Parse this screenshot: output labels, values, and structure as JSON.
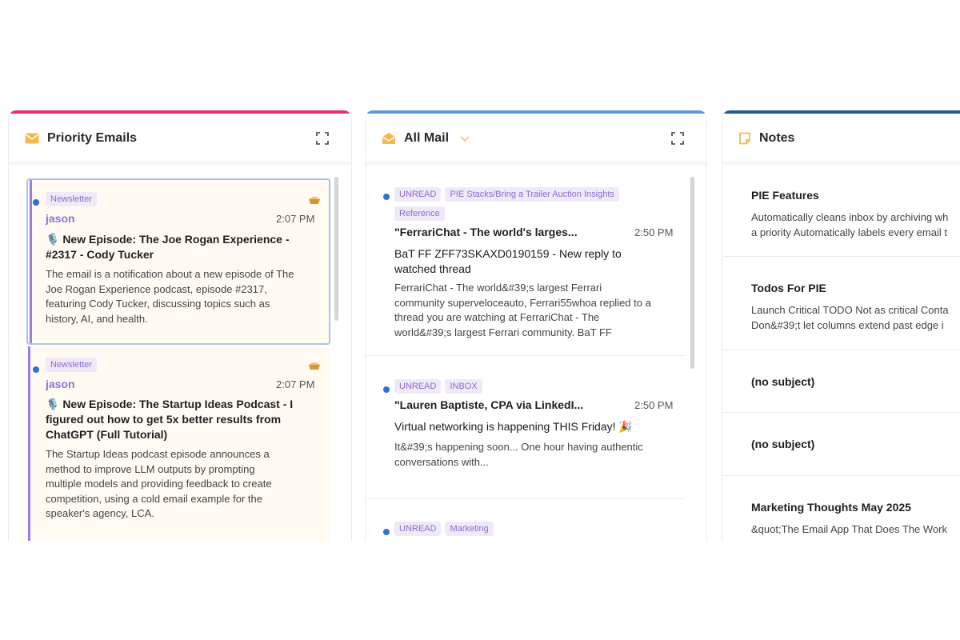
{
  "colors": {
    "priority_bar": "#e8306d",
    "allmail_bar": "#5b96d9",
    "notes_bar": "#27598f",
    "tag_text": "#8a6fd0",
    "sender": "#8e72d8",
    "unread_dot": "#2f6fd6"
  },
  "priority": {
    "title": "Priority Emails",
    "icon": "envelope-icon",
    "emails": [
      {
        "tag": "Newsletter",
        "sender": "jason",
        "time": "2:07 PM",
        "subject_line1": "🎙️ New Episode: The Joe Rogan Experience -",
        "subject_line2": "#2317 - Cody Tucker",
        "preview_lines": [
          "The email is a notification about a new episode of The",
          "Joe Rogan Experience podcast, episode #2317,",
          "featuring Cody Tucker, discussing topics such as",
          "history, AI, and health."
        ]
      },
      {
        "tag": "Newsletter",
        "sender": "jason",
        "time": "2:07 PM",
        "subject_line1": "🎙️ New Episode: The Startup Ideas Podcast - I",
        "subject_line2": "figured out how to get 5x better results from",
        "subject_line3": "ChatGPT (Full Tutorial)",
        "preview_lines": [
          "The Startup Ideas podcast episode announces a",
          "method to improve LLM outputs by prompting",
          "multiple models and providing feedback to create",
          "competition, using a cold email example for the",
          "speaker's agency, LCA."
        ]
      }
    ]
  },
  "allmail": {
    "title": "All Mail",
    "icon": "open-envelope-icon",
    "emails": [
      {
        "tags": [
          "UNREAD",
          "PIE Stacks/Bring a Trailer Auction Insights"
        ],
        "tags2": [
          "Reference"
        ],
        "from": "\"FerrariChat - The world's larges...",
        "time": "2:50 PM",
        "subject_line1": "BaT FF ZFF73SKAXD0190159 - New reply to",
        "subject_line2": "watched thread",
        "preview_lines": [
          "FerrariChat - The world&#39;s largest Ferrari",
          "community superveloceauto, Ferrari55whoa replied to a",
          "thread you are watching at FerrariChat - The",
          "world&#39;s largest Ferrari community. BaT FF"
        ]
      },
      {
        "tags": [
          "UNREAD",
          "INBOX"
        ],
        "from": "\"Lauren Baptiste, CPA via LinkedI...",
        "time": "2:50 PM",
        "subject_line1": "Virtual networking is happening THIS Friday! 🎉",
        "preview_lines": [
          "It&#39;s happening soon...  One hour having authentic",
          "conversations with..."
        ]
      },
      {
        "tags": [
          "UNREAD",
          "Marketing"
        ]
      }
    ]
  },
  "notes": {
    "title": "Notes",
    "icon": "note-icon",
    "items": [
      {
        "title": "PIE Features",
        "lines": [
          "Automatically cleans inbox by archiving wh",
          "a priority Automatically labels every email t"
        ]
      },
      {
        "title": "Todos For PIE",
        "lines": [
          "Launch Critical TODO Not as critical Conta",
          "Don&#39;t let columns extend past edge i"
        ]
      },
      {
        "title": "(no subject)",
        "lines": []
      },
      {
        "title": "(no subject)",
        "lines": []
      },
      {
        "title": "Marketing Thoughts May 2025",
        "lines": [
          "&quot;The Email App That Does The Work"
        ]
      }
    ]
  }
}
